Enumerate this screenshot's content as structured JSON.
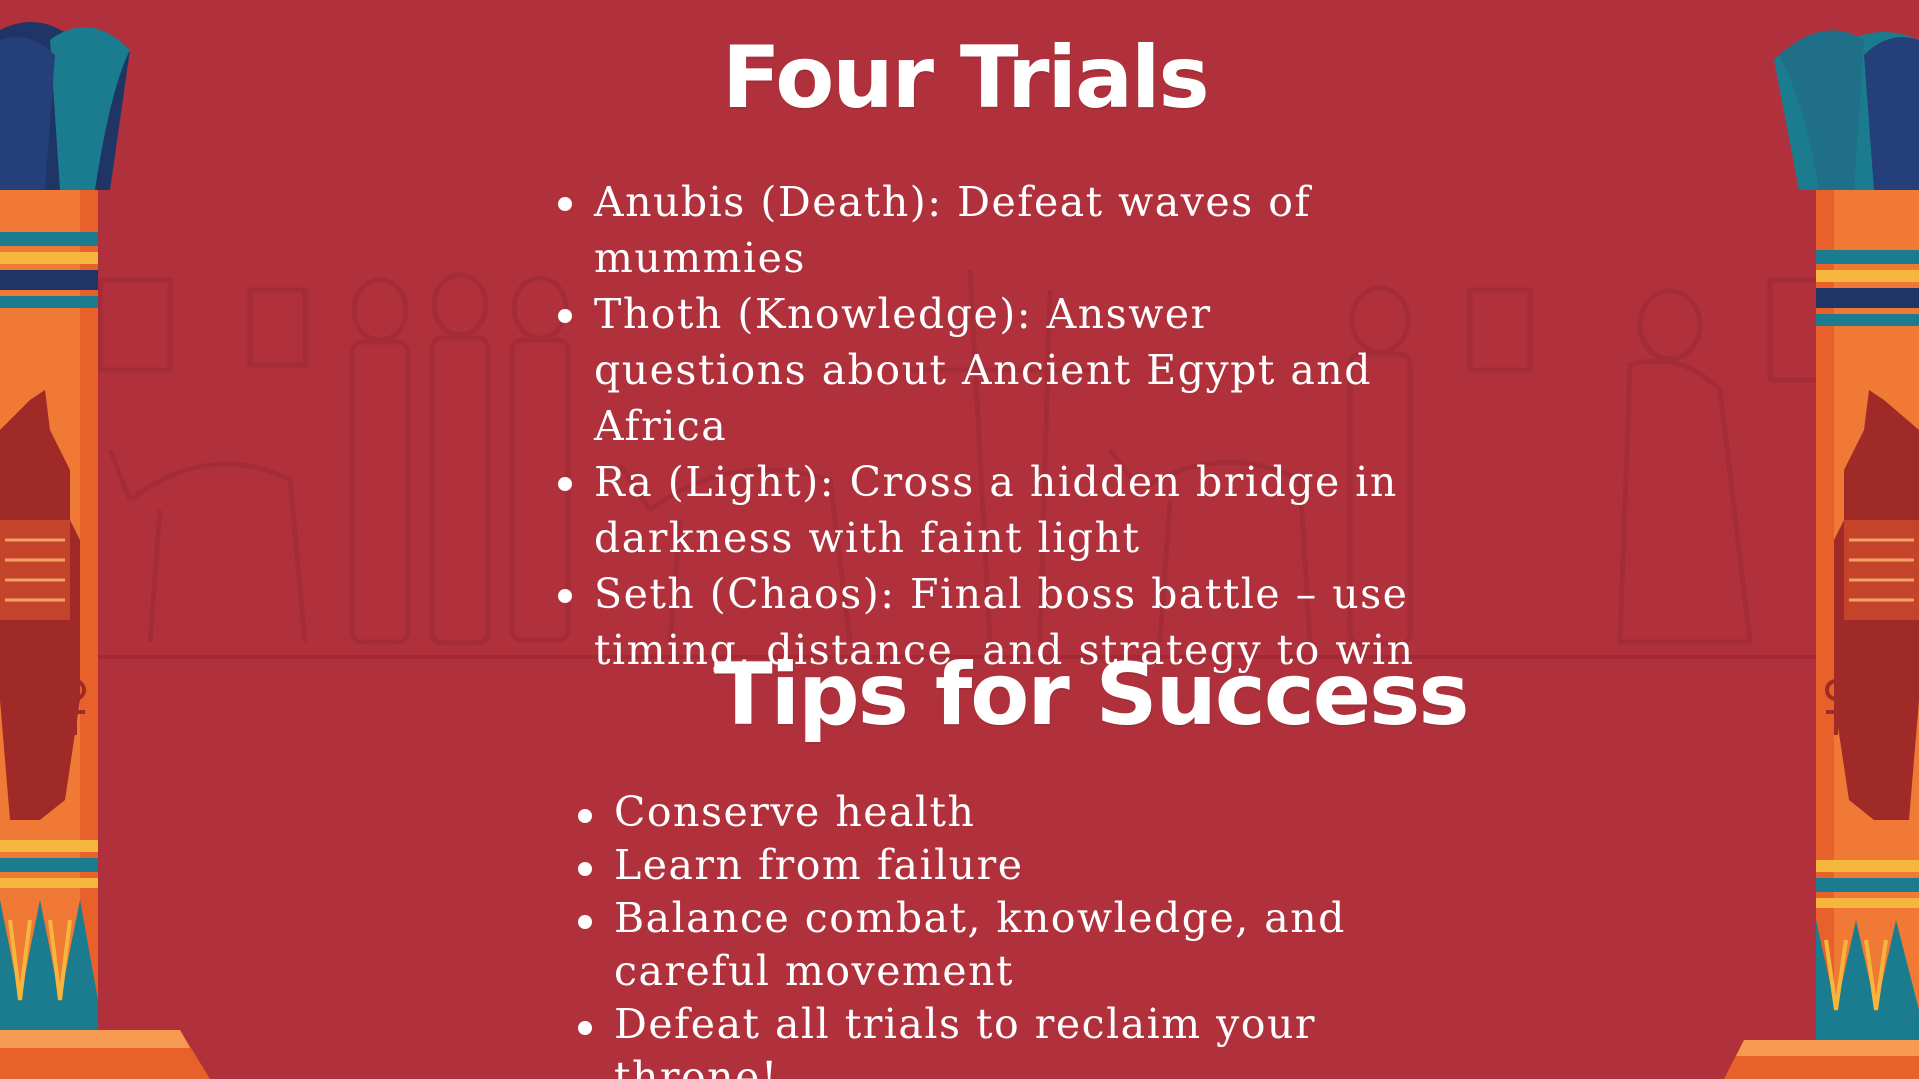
{
  "trials": {
    "title": "Four Trials",
    "items": [
      "Anubis (Death): Defeat waves of mummies",
      "Thoth (Knowledge): Answer questions about Ancient Egypt and Africa",
      "Ra (Light): Cross a hidden bridge in darkness with faint light",
      "Seth (Chaos): Final boss battle – use timing, distance, and strategy to win"
    ]
  },
  "tips": {
    "title": "Tips for Success",
    "items": [
      "Conserve health",
      "Learn from failure",
      "Balance combat, knowledge, and careful movement",
      "Defeat all trials to reclaim your throne!"
    ]
  },
  "colors": {
    "background": "#b0313c",
    "pillar_orange": "#f07a35",
    "pillar_teal": "#1a7c8e",
    "pillar_navy": "#1f3566",
    "text": "#ffffff"
  },
  "icons": {
    "left_pillar": "egyptian-column-anubis-icon",
    "right_pillar": "egyptian-column-anubis-icon",
    "background": "egyptian-frieze-figures"
  }
}
